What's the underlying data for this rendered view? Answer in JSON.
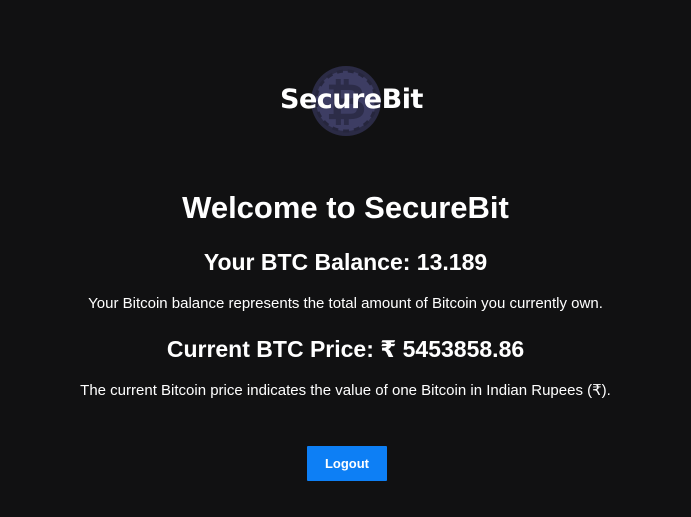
{
  "brand": {
    "name": "SecureBit",
    "coin_icon": "bitcoin-coin-icon",
    "coin_color": "#3d3d63"
  },
  "main": {
    "title": "Welcome to SecureBit",
    "balance_heading": "Your BTC Balance: 13.189",
    "balance_description": "Your Bitcoin balance represents the total amount of Bitcoin you currently own.",
    "price_heading": "Current BTC Price: ₹ 5453858.86",
    "price_description": "The current Bitcoin price indicates the value of one Bitcoin in Indian Rupees (₹)."
  },
  "actions": {
    "logout_label": "Logout",
    "button_color": "#0d7ff5"
  }
}
